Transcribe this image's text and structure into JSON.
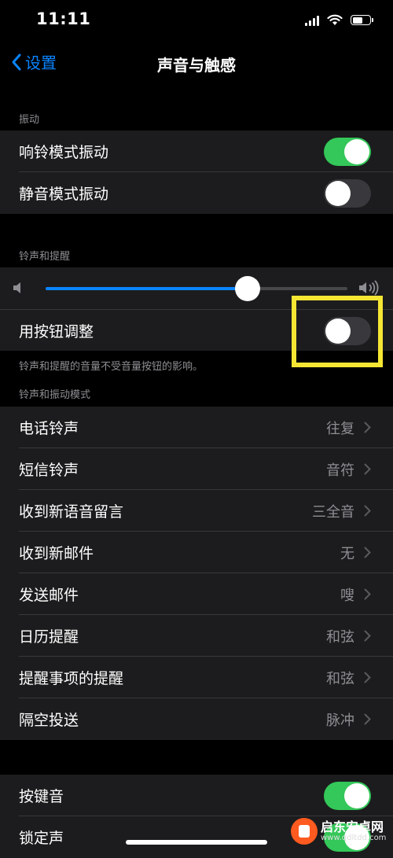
{
  "status_bar": {
    "time": "11:11"
  },
  "nav": {
    "back_label": "设置",
    "title": "声音与触感"
  },
  "vibration": {
    "header": "振动",
    "rows": [
      {
        "label": "响铃模式振动",
        "on": true
      },
      {
        "label": "静音模式振动",
        "on": false
      }
    ]
  },
  "ringer": {
    "header": "铃声和提醒",
    "volume_fraction": 0.67,
    "adjust_label": "用按钮调整",
    "adjust_on": false,
    "footnote": "铃声和提醒的音量不受音量按钮的影响。"
  },
  "patterns": {
    "header": "铃声和振动模式",
    "rows": [
      {
        "label": "电话铃声",
        "value": "往复"
      },
      {
        "label": "短信铃声",
        "value": "音符"
      },
      {
        "label": "收到新语音留言",
        "value": "三全音"
      },
      {
        "label": "收到新邮件",
        "value": "无"
      },
      {
        "label": "发送邮件",
        "value": "嗖"
      },
      {
        "label": "日历提醒",
        "value": "和弦"
      },
      {
        "label": "提醒事项的提醒",
        "value": "和弦"
      },
      {
        "label": "隔空投送",
        "value": "脉冲"
      }
    ]
  },
  "system": {
    "rows": [
      {
        "label": "按键音",
        "on": true
      },
      {
        "label": "锁定声",
        "on": true
      }
    ]
  },
  "watermark": {
    "name": "启东安卓网",
    "url": "www.qdltdd.com"
  },
  "colors": {
    "accent": "#0a84ff",
    "toggle_on": "#34c759",
    "highlight": "#f5e633"
  }
}
